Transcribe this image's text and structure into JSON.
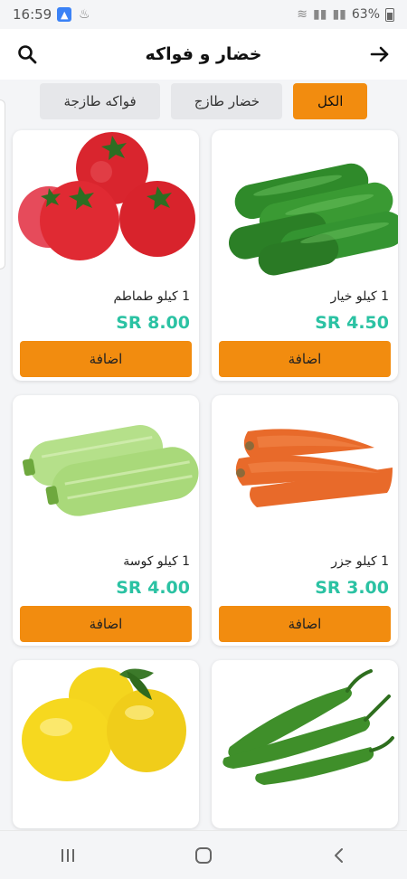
{
  "status_bar": {
    "time": "16:59",
    "battery": "63%"
  },
  "header": {
    "title": "خضار و فواكه"
  },
  "tabs": [
    {
      "label": "الكل",
      "active": true
    },
    {
      "label": "خضار طازج",
      "active": false
    },
    {
      "label": "فواكه طازجة",
      "active": false
    }
  ],
  "products": [
    {
      "name": "1 كيلو خيار",
      "price": "SR 4.50",
      "button": "اضافة",
      "icon": "cucumber-image"
    },
    {
      "name": "1 كيلو طماطم",
      "price": "SR 8.00",
      "button": "اضافة",
      "icon": "tomato-image"
    },
    {
      "name": "1 كيلو جزر",
      "price": "SR 3.00",
      "button": "اضافة",
      "icon": "carrot-image"
    },
    {
      "name": "1 كيلو كوسة",
      "price": "SR 4.00",
      "button": "اضافة",
      "icon": "zucchini-image"
    },
    {
      "name": "",
      "price": "",
      "button": "",
      "icon": "green-chili-image"
    },
    {
      "name": "",
      "price": "",
      "button": "",
      "icon": "lemon-image"
    }
  ],
  "colors": {
    "accent": "#f28c0f",
    "price": "#2bc2a3"
  }
}
